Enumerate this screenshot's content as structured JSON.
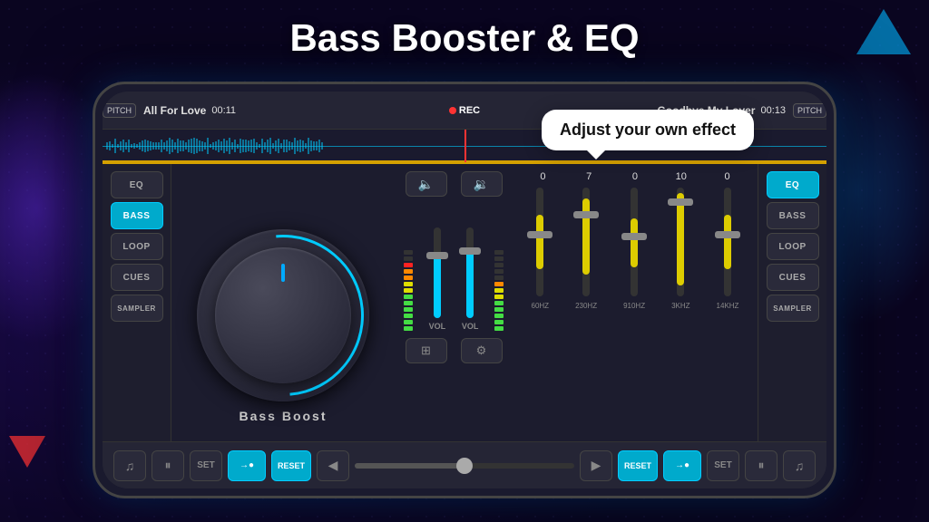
{
  "page": {
    "title": "Bass Booster & EQ",
    "bg_color": "#0a0520"
  },
  "tooltip": {
    "text": "Adjust your own effect"
  },
  "phone": {
    "top_bar": {
      "track_left": "All For Love",
      "time_left": "00:11",
      "rec_label": "REC",
      "track_right": "Goodbye My Lover",
      "time_right": "00:13",
      "pitch_label": "PITCH"
    },
    "left_panel": {
      "buttons": [
        "EQ",
        "BASS",
        "LOOP",
        "CUES",
        "SAMPLER"
      ]
    },
    "right_panel": {
      "buttons": [
        "EQ",
        "BASS",
        "LOOP",
        "CUES",
        "SAMPLER"
      ]
    },
    "knob": {
      "label": "Bass Boost"
    },
    "eq": {
      "values": [
        "0",
        "7",
        "0",
        "10",
        "0"
      ],
      "freqs": [
        "60HZ",
        "230HZ",
        "910HZ",
        "3KHZ",
        "14KHZ"
      ],
      "slider_positions": [
        50,
        30,
        55,
        15,
        50
      ]
    },
    "transport": {
      "set_left": "SET",
      "reset_left": "RESET",
      "reset_right": "RESET",
      "set_right": "SET",
      "vol_left": "VOL",
      "vol_right": "VOL"
    }
  }
}
